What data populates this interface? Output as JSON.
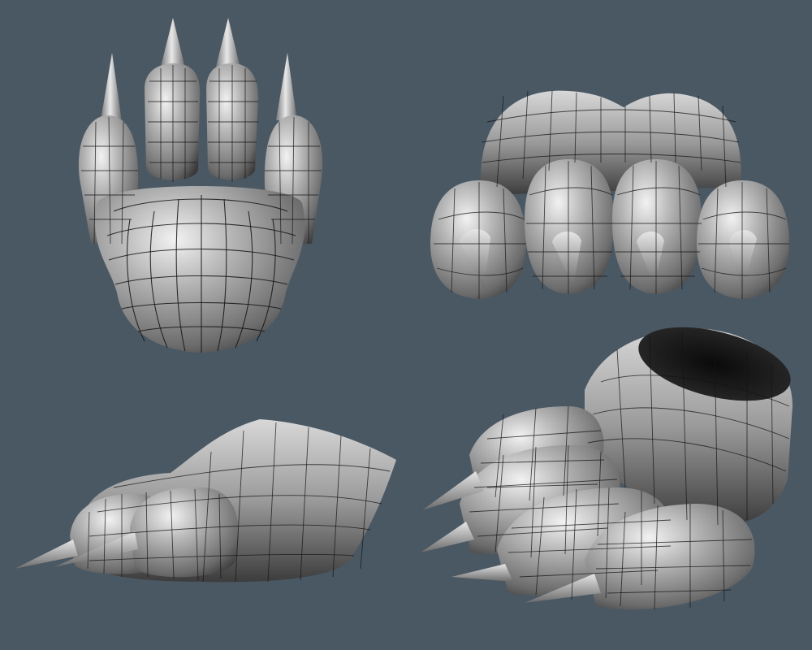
{
  "scene": {
    "background": "#4a5864",
    "mesh_color": "#9a9a9a",
    "wire_color": "#141414",
    "claw_color": "#b8b8b8"
  },
  "views": [
    {
      "id": "top",
      "name": "paw-top-view"
    },
    {
      "id": "front",
      "name": "paw-front-view"
    },
    {
      "id": "side",
      "name": "paw-side-view"
    },
    {
      "id": "perspective",
      "name": "paw-perspective-view"
    }
  ]
}
